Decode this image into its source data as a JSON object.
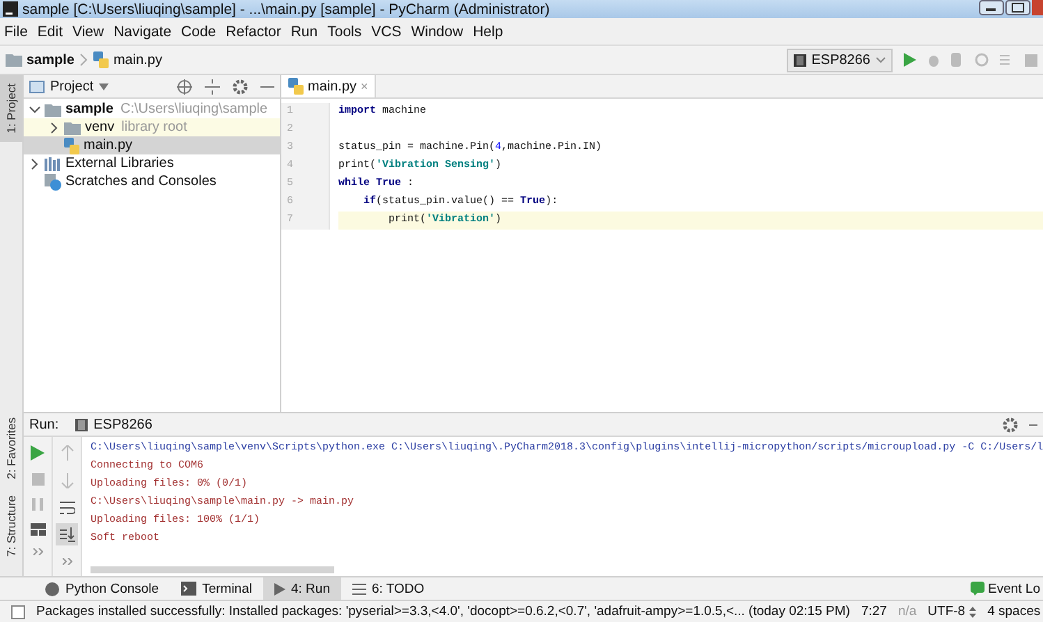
{
  "window": {
    "title": "sample [C:\\Users\\liuqing\\sample] - ...\\main.py [sample] - PyCharm (Administrator)"
  },
  "menu": [
    "File",
    "Edit",
    "View",
    "Navigate",
    "Code",
    "Refactor",
    "Run",
    "Tools",
    "VCS",
    "Window",
    "Help"
  ],
  "breadcrumbs": [
    {
      "label": "sample",
      "kind": "folder"
    },
    {
      "label": "main.py",
      "kind": "python"
    }
  ],
  "run_config": {
    "label": "ESP8266"
  },
  "left_stripe": [
    {
      "label": "1: Project",
      "selected": true
    },
    {
      "label": "2: Favorites",
      "selected": false
    },
    {
      "label": "7: Structure",
      "selected": false
    }
  ],
  "project_panel": {
    "title": "Project",
    "tree": [
      {
        "label": "sample",
        "hint": "C:\\Users\\liuqing\\sample",
        "kind": "folder",
        "expanded": true,
        "selected": false,
        "children": [
          {
            "label": "venv",
            "hint": "library root",
            "kind": "folder",
            "expanded": false,
            "selected": false
          },
          {
            "label": "main.py",
            "kind": "python",
            "selected": true
          }
        ]
      },
      {
        "label": "External Libraries",
        "kind": "library",
        "expanded": false,
        "selected": false
      },
      {
        "label": "Scratches and Consoles",
        "kind": "scratch",
        "selected": false
      }
    ]
  },
  "editor": {
    "tabs": [
      {
        "label": "main.py",
        "close": "×",
        "selected": true
      }
    ],
    "lines": [
      {
        "number": "1",
        "current": false,
        "tokens": [
          {
            "kind": "keyword",
            "text": "import"
          },
          {
            "kind": "plain",
            "text": " machine"
          }
        ]
      },
      {
        "number": "2",
        "current": false
      },
      {
        "number": "3",
        "current": false,
        "tokens": [
          {
            "kind": "plain",
            "text": "status_pin = machine.Pin("
          },
          {
            "kind": "number",
            "text": "4"
          },
          {
            "kind": "plain",
            "text": ",machine.Pin.IN)"
          }
        ]
      },
      {
        "number": "4",
        "current": false,
        "tokens": [
          {
            "kind": "plain",
            "text": "print("
          },
          {
            "kind": "string",
            "text": "'Vibration Sensing'"
          },
          {
            "kind": "plain",
            "text": ")"
          }
        ]
      },
      {
        "number": "5",
        "current": false,
        "tokens": [
          {
            "kind": "keyword",
            "text": "while"
          },
          {
            "kind": "keyword",
            "text": " True"
          },
          {
            "kind": "plain",
            "text": " :"
          }
        ]
      },
      {
        "number": "6",
        "current": false,
        "tokens": [
          {
            "kind": "keyword",
            "text": "    if"
          },
          {
            "kind": "plain",
            "text": "(status_pin.value() == "
          },
          {
            "kind": "keyword",
            "text": "True"
          },
          {
            "kind": "plain",
            "text": "):"
          }
        ]
      },
      {
        "number": "7",
        "current": true,
        "tokens": [
          {
            "kind": "plain",
            "text": "        print("
          },
          {
            "kind": "string",
            "text": "'Vibration'"
          },
          {
            "kind": "plain",
            "text": ")"
          }
        ]
      }
    ]
  },
  "run_panel": {
    "label": "Run:",
    "tab": "ESP8266",
    "console": [
      {
        "kind": "command",
        "text": "C:\\Users\\liuqing\\sample\\venv\\Scripts\\python.exe C:\\Users\\liuqing\\.PyCharm2018.3\\config\\plugins\\intellij-micropython/scripts/microupload.py -C C:/Users/l"
      },
      {
        "kind": "output",
        "text": "Connecting to COM6"
      },
      {
        "kind": "output",
        "text": "Uploading files: 0% (0/1)"
      },
      {
        "kind": "output",
        "text": "C:\\Users\\liuqing\\sample\\main.py -> main.py"
      },
      {
        "kind": "output",
        "text": "Uploading files: 100% (1/1)"
      },
      {
        "kind": "output",
        "text": "Soft reboot"
      }
    ]
  },
  "tool_tabs": [
    {
      "label": "Python Console",
      "kind": "python",
      "selected": false
    },
    {
      "label": "Terminal",
      "kind": "terminal",
      "selected": false
    },
    {
      "label": "4: Run",
      "kind": "run",
      "selected": true
    },
    {
      "label": "6: TODO",
      "kind": "todo",
      "selected": false
    }
  ],
  "event_log": "Event Lo",
  "status_bar": {
    "message": "Packages installed successfully: Installed packages: 'pyserial>=3.3,<4.0', 'docopt>=0.6.2,<0.7', 'adafruit-ampy>=1.0.5,<... (today 02:15 PM)",
    "position": "7:27",
    "vcs": "n/a",
    "encoding": "UTF-8",
    "indent": "4 spaces"
  }
}
